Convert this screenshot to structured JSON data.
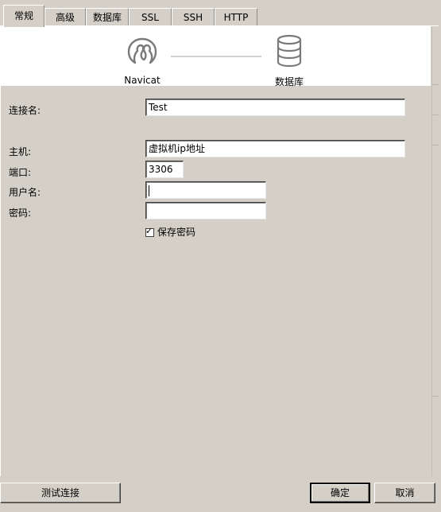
{
  "tabs": [
    {
      "label": "常规",
      "active": true
    },
    {
      "label": "高级",
      "active": false
    },
    {
      "label": "数据库",
      "active": false
    },
    {
      "label": "SSL",
      "active": false
    },
    {
      "label": "SSH",
      "active": false
    },
    {
      "label": "HTTP",
      "active": false
    }
  ],
  "header": {
    "left_label": "Navicat",
    "right_label": "数据库",
    "left_icon": "navicat-logo-icon",
    "right_icon": "database-icon"
  },
  "form": {
    "connection_name_label": "连接名:",
    "connection_name_value": "Test",
    "host_label": "主机:",
    "host_value": "虚拟机ip地址",
    "port_label": "端口:",
    "port_value": "3306",
    "username_label": "用户名:",
    "username_value": "",
    "password_label": "密码:",
    "password_value": "",
    "save_password_label": "保存密码",
    "save_password_checked": true
  },
  "footer": {
    "test_connection_label": "测试连接",
    "ok_label": "确定",
    "cancel_label": "取消"
  }
}
